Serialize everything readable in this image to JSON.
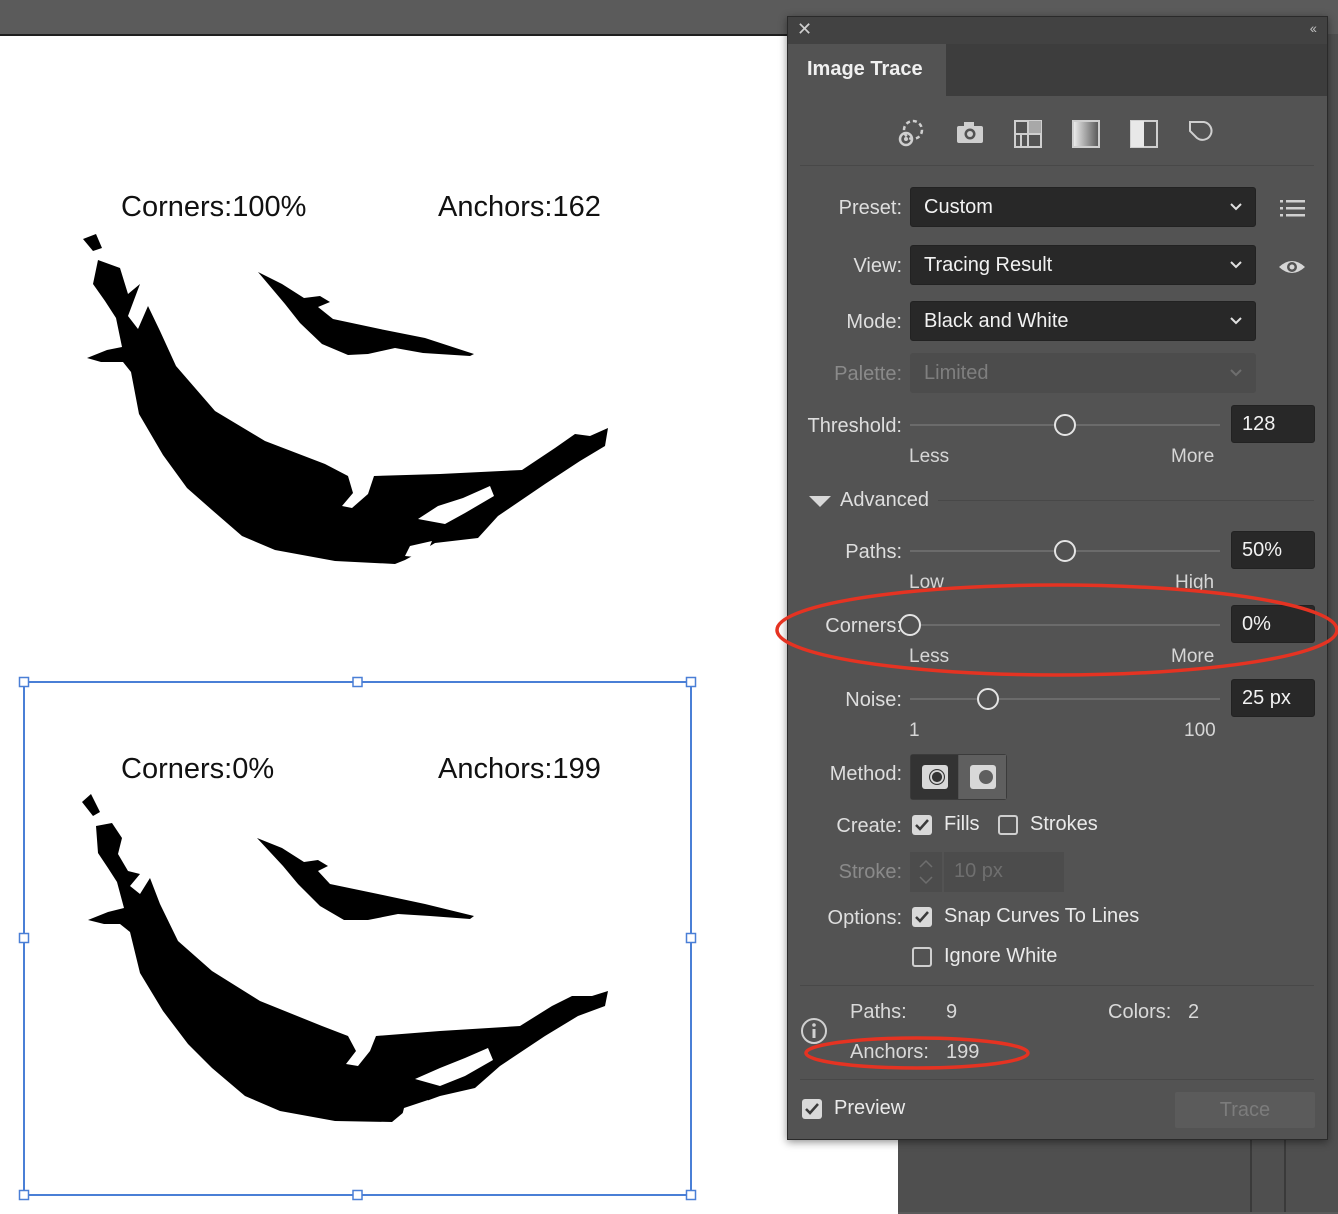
{
  "canvas": {
    "top_art": {
      "corners_label": "Corners:100%",
      "anchors_label": "Anchors:162"
    },
    "bottom_art": {
      "corners_label": "Corners:0%",
      "anchors_label": "Anchors:199"
    }
  },
  "panel": {
    "title": "Image Trace",
    "preset_icons": [
      "auto-color-icon",
      "high-color-icon",
      "low-color-icon",
      "grayscale-icon",
      "black-and-white-icon",
      "outline-icon"
    ],
    "preset": {
      "label": "Preset:",
      "value": "Custom"
    },
    "view": {
      "label": "View:",
      "value": "Tracing Result"
    },
    "mode": {
      "label": "Mode:",
      "value": "Black and White"
    },
    "palette": {
      "label": "Palette:",
      "value": "Limited"
    },
    "threshold": {
      "label": "Threshold:",
      "value": "128",
      "level": 0.5,
      "min_label": "Less",
      "max_label": "More"
    },
    "advanced": {
      "label": "Advanced"
    },
    "paths": {
      "label": "Paths:",
      "value": "50%",
      "level": 0.5,
      "min_label": "Low",
      "max_label": "High"
    },
    "corners": {
      "label": "Corners:",
      "value": "0%",
      "level": 0.0,
      "min_label": "Less",
      "max_label": "More"
    },
    "noise": {
      "label": "Noise:",
      "value": "25 px",
      "level": 0.25,
      "min_label": "1",
      "max_label": "100"
    },
    "method": {
      "label": "Method:",
      "selected": "abutting"
    },
    "create": {
      "label": "Create:",
      "fills_label": "Fills",
      "fills_checked": true,
      "strokes_label": "Strokes",
      "strokes_checked": false
    },
    "stroke": {
      "label": "Stroke:",
      "value": "10 px"
    },
    "options": {
      "label": "Options:",
      "snap_label": "Snap Curves To Lines",
      "snap_checked": true,
      "ignore_white_label": "Ignore White",
      "ignore_white_checked": false
    },
    "stats": {
      "paths_label": "Paths:",
      "paths_value": "9",
      "colors_label": "Colors:",
      "colors_value": "2",
      "anchors_label": "Anchors:",
      "anchors_value": "199"
    },
    "preview": {
      "label": "Preview",
      "checked": true
    },
    "trace_button": "Trace"
  },
  "annotation_color": "#e53322",
  "selection_color": "#4a7fd6"
}
